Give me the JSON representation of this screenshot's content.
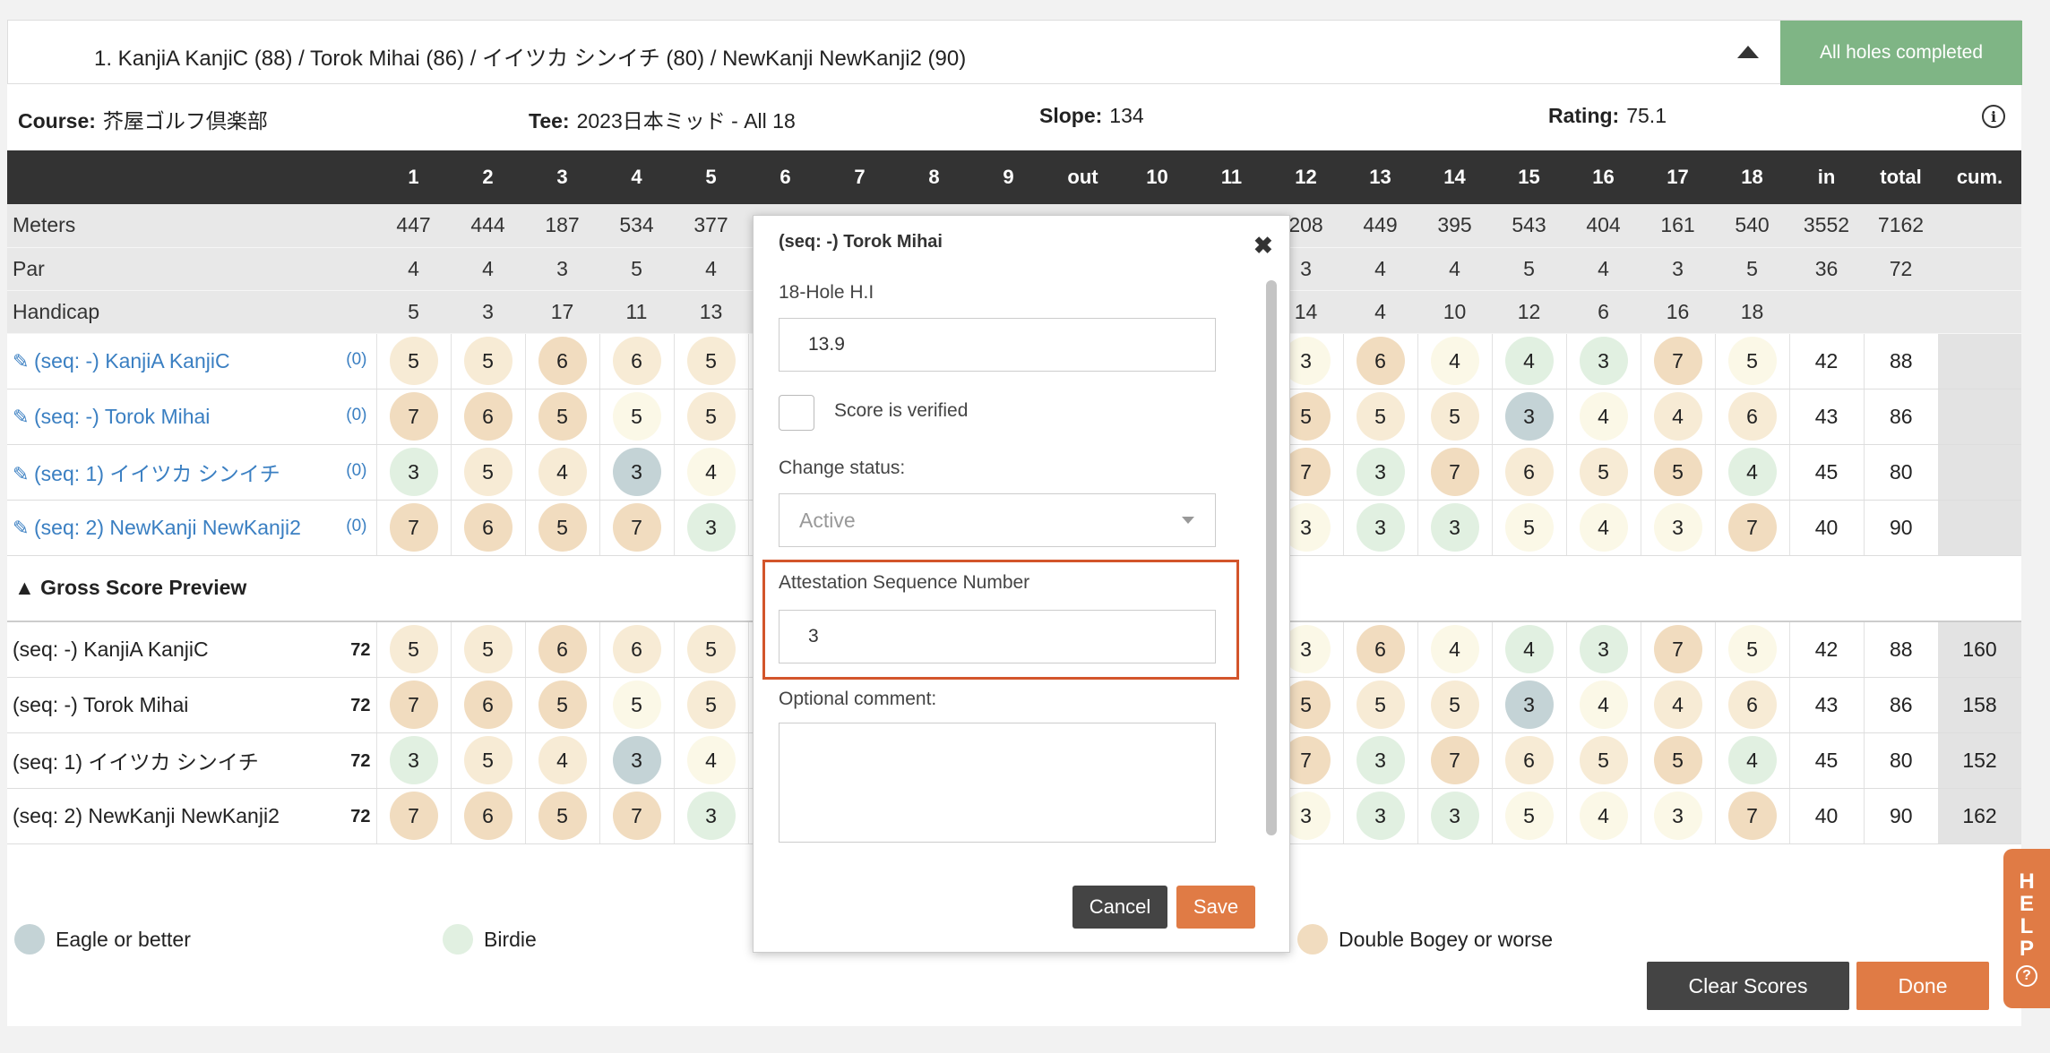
{
  "summary": {
    "text": "1.   KanjiA KanjiC (88)   /   Torok Mihai (86)   /   イイツカ シンイチ (80)   /   NewKanji NewKanji2 (90)",
    "status": "All holes completed"
  },
  "info": {
    "course_label": "Course:",
    "course_value": "芥屋ゴルフ倶楽部",
    "tee_label": "Tee:",
    "tee_value": "2023日本ミッド - All 18",
    "slope_label": "Slope:",
    "slope_value": "134",
    "rating_label": "Rating:",
    "rating_value": "75.1",
    "info_icon": "i"
  },
  "table": {
    "headers": [
      "1",
      "2",
      "3",
      "4",
      "5",
      "6",
      "7",
      "8",
      "9",
      "out",
      "10",
      "11",
      "12",
      "13",
      "14",
      "15",
      "16",
      "17",
      "18",
      "in",
      "total",
      "cum."
    ],
    "meters_label": "Meters",
    "par_label": "Par",
    "handicap_label": "Handicap",
    "meters": [
      "447",
      "444",
      "187",
      "534",
      "377",
      "",
      "",
      "",
      "",
      "",
      "",
      "",
      "208",
      "449",
      "395",
      "543",
      "404",
      "161",
      "540",
      "3552",
      "7162",
      ""
    ],
    "par": [
      "4",
      "4",
      "3",
      "5",
      "4",
      "",
      "",
      "",
      "",
      "",
      "",
      "",
      "3",
      "4",
      "4",
      "5",
      "4",
      "3",
      "5",
      "36",
      "72",
      ""
    ],
    "handicap": [
      "5",
      "3",
      "17",
      "11",
      "13",
      "",
      "",
      "",
      "",
      "",
      "",
      "",
      "14",
      "4",
      "10",
      "12",
      "6",
      "16",
      "18",
      "",
      "",
      ""
    ],
    "players": [
      {
        "name": "(seq: -) KanjiA KanjiC",
        "hcp": "(0)",
        "scores": [
          "5",
          "5",
          "6",
          "6",
          "5",
          "",
          "",
          "",
          "",
          "",
          "",
          "",
          "3",
          "6",
          "4",
          "4",
          "3",
          "7",
          "5",
          "42",
          "88",
          ""
        ]
      },
      {
        "name": "(seq: -) Torok Mihai",
        "hcp": "(0)",
        "scores": [
          "7",
          "6",
          "5",
          "5",
          "5",
          "",
          "",
          "",
          "",
          "",
          "",
          "",
          "5",
          "5",
          "5",
          "3",
          "4",
          "4",
          "6",
          "43",
          "86",
          ""
        ]
      },
      {
        "name": "(seq: 1) イイツカ シンイチ",
        "hcp": "(0)",
        "scores": [
          "3",
          "5",
          "4",
          "3",
          "4",
          "",
          "",
          "",
          "",
          "",
          "",
          "",
          "7",
          "3",
          "7",
          "6",
          "5",
          "5",
          "4",
          "45",
          "80",
          ""
        ]
      },
      {
        "name": "(seq: 2) NewKanji NewKanji2",
        "hcp": "(0)",
        "scores": [
          "7",
          "6",
          "5",
          "7",
          "3",
          "",
          "",
          "",
          "",
          "",
          "",
          "",
          "3",
          "3",
          "3",
          "5",
          "4",
          "3",
          "7",
          "40",
          "90",
          ""
        ]
      }
    ],
    "gross_title": "Gross Score Preview",
    "gross": [
      {
        "name": "(seq: -) KanjiA KanjiC",
        "par": "72",
        "scores": [
          "5",
          "5",
          "6",
          "6",
          "5",
          "",
          "",
          "",
          "",
          "",
          "",
          "",
          "3",
          "6",
          "4",
          "4",
          "3",
          "7",
          "5",
          "42",
          "88",
          "160"
        ]
      },
      {
        "name": "(seq: -) Torok Mihai",
        "par": "72",
        "scores": [
          "7",
          "6",
          "5",
          "5",
          "5",
          "",
          "",
          "",
          "",
          "",
          "",
          "",
          "5",
          "5",
          "5",
          "3",
          "4",
          "4",
          "6",
          "43",
          "86",
          "158"
        ]
      },
      {
        "name": "(seq: 1) イイツカ シンイチ",
        "par": "72",
        "scores": [
          "3",
          "5",
          "4",
          "3",
          "4",
          "",
          "",
          "",
          "",
          "",
          "",
          "",
          "7",
          "3",
          "7",
          "6",
          "5",
          "5",
          "4",
          "45",
          "80",
          "152"
        ]
      },
      {
        "name": "(seq: 2) NewKanji NewKanji2",
        "par": "72",
        "scores": [
          "7",
          "6",
          "5",
          "7",
          "3",
          "",
          "",
          "",
          "",
          "",
          "",
          "",
          "3",
          "3",
          "3",
          "5",
          "4",
          "3",
          "7",
          "40",
          "90",
          "162"
        ]
      }
    ]
  },
  "legend": {
    "eagle": "Eagle or better",
    "birdie": "Birdie",
    "double": "Double Bogey or worse"
  },
  "buttons": {
    "clear": "Clear Scores",
    "done": "Done",
    "help": [
      "H",
      "E",
      "L",
      "P"
    ],
    "help_q": "?"
  },
  "modal": {
    "title": "(seq: -) Torok Mihai",
    "close": "✖",
    "hi_label": "18-Hole H.I",
    "hi_value": "13.9",
    "verified_label": "Score is verified",
    "status_label": "Change status:",
    "status_value": "Active",
    "attest_label": "Attestation Sequence Number",
    "attest_value": "3",
    "comment_label": "Optional comment:",
    "cancel": "Cancel",
    "save": "Save"
  },
  "colors": {
    "header_bg": "#333333",
    "status_green": "#7fb585",
    "accent_orange": "#e07b45",
    "link_blue": "#3a7fc2",
    "eagle": "#c4d3d6",
    "birdie": "#e1f0e1",
    "par": "#fbf8e7",
    "bogey": "#f7ebd5",
    "double_bogey": "#f1dcbf",
    "highlight": "#d3552b"
  }
}
